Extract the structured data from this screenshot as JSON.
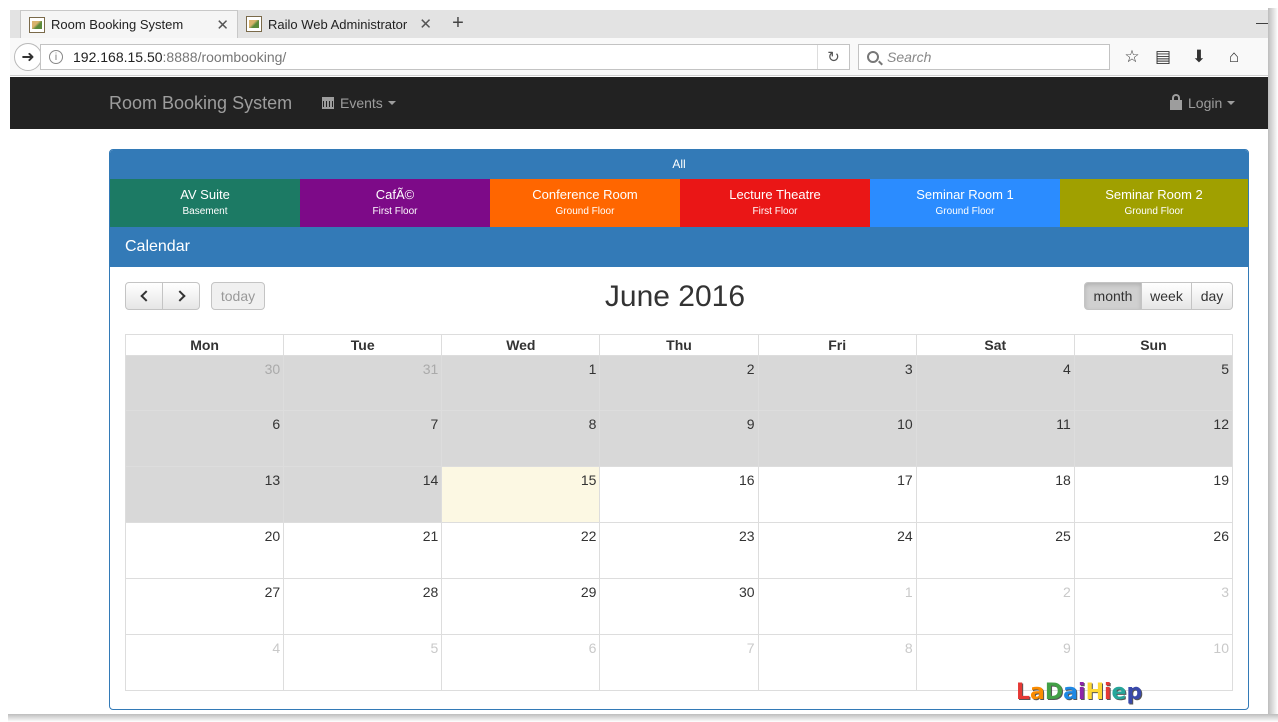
{
  "browser": {
    "tabs": [
      {
        "label": "Room Booking System",
        "active": true
      },
      {
        "label": "Railo Web Administrator",
        "active": false
      }
    ],
    "url_host": "192.168.15.50",
    "url_path": ":8888/roombooking/",
    "search_placeholder": "Search"
  },
  "navbar": {
    "brand": "Room Booking System",
    "events_label": "Events",
    "login_label": "Login"
  },
  "panel": {
    "all_label": "All",
    "rooms": [
      {
        "name": "AV Suite",
        "floor": "Basement",
        "color": "#1c7a64"
      },
      {
        "name": "CafÃ©",
        "floor": "First Floor",
        "color": "#7d0a88"
      },
      {
        "name": "Conference Room",
        "floor": "Ground Floor",
        "color": "#ff6600"
      },
      {
        "name": "Lecture Theatre",
        "floor": "First Floor",
        "color": "#ea1616"
      },
      {
        "name": "Seminar Room 1",
        "floor": "Ground Floor",
        "color": "#2b8cff"
      },
      {
        "name": "Seminar Room 2",
        "floor": "Ground Floor",
        "color": "#a0a000"
      }
    ],
    "calendar_heading": "Calendar"
  },
  "calendar": {
    "title": "June 2016",
    "today_label": "today",
    "views": [
      {
        "label": "month",
        "active": true
      },
      {
        "label": "week",
        "active": false
      },
      {
        "label": "day",
        "active": false
      }
    ],
    "days_of_week": [
      "Mon",
      "Tue",
      "Wed",
      "Thu",
      "Fri",
      "Sat",
      "Sun"
    ],
    "weeks": [
      [
        {
          "d": "30",
          "other": true,
          "past": true
        },
        {
          "d": "31",
          "other": true,
          "past": true
        },
        {
          "d": "1",
          "past": true
        },
        {
          "d": "2",
          "past": true
        },
        {
          "d": "3",
          "past": true
        },
        {
          "d": "4",
          "past": true
        },
        {
          "d": "5",
          "past": true
        }
      ],
      [
        {
          "d": "6",
          "past": true
        },
        {
          "d": "7",
          "past": true
        },
        {
          "d": "8",
          "past": true
        },
        {
          "d": "9",
          "past": true
        },
        {
          "d": "10",
          "past": true
        },
        {
          "d": "11",
          "past": true
        },
        {
          "d": "12",
          "past": true
        }
      ],
      [
        {
          "d": "13",
          "past": true
        },
        {
          "d": "14",
          "past": true
        },
        {
          "d": "15",
          "today": true
        },
        {
          "d": "16"
        },
        {
          "d": "17"
        },
        {
          "d": "18"
        },
        {
          "d": "19"
        }
      ],
      [
        {
          "d": "20"
        },
        {
          "d": "21"
        },
        {
          "d": "22"
        },
        {
          "d": "23"
        },
        {
          "d": "24"
        },
        {
          "d": "25"
        },
        {
          "d": "26"
        }
      ],
      [
        {
          "d": "27"
        },
        {
          "d": "28"
        },
        {
          "d": "29"
        },
        {
          "d": "30"
        },
        {
          "d": "1",
          "other": true
        },
        {
          "d": "2",
          "other": true
        },
        {
          "d": "3",
          "other": true
        }
      ],
      [
        {
          "d": "4",
          "other": true
        },
        {
          "d": "5",
          "other": true
        },
        {
          "d": "6",
          "other": true
        },
        {
          "d": "7",
          "other": true
        },
        {
          "d": "8",
          "other": true
        },
        {
          "d": "9",
          "other": true
        },
        {
          "d": "10",
          "other": true
        }
      ]
    ]
  },
  "watermark": {
    "letters": [
      {
        "ch": "L",
        "color": "#e53935"
      },
      {
        "ch": "a",
        "color": "#fb8c00"
      },
      {
        "ch": "D",
        "color": "#43a047"
      },
      {
        "ch": "a",
        "color": "#1e88e5"
      },
      {
        "ch": "i",
        "color": "#8e24aa"
      },
      {
        "ch": "H",
        "color": "#fdd835"
      },
      {
        "ch": "i",
        "color": "#e53935"
      },
      {
        "ch": "e",
        "color": "#26a69a"
      },
      {
        "ch": "p",
        "color": "#3949ab"
      }
    ]
  }
}
